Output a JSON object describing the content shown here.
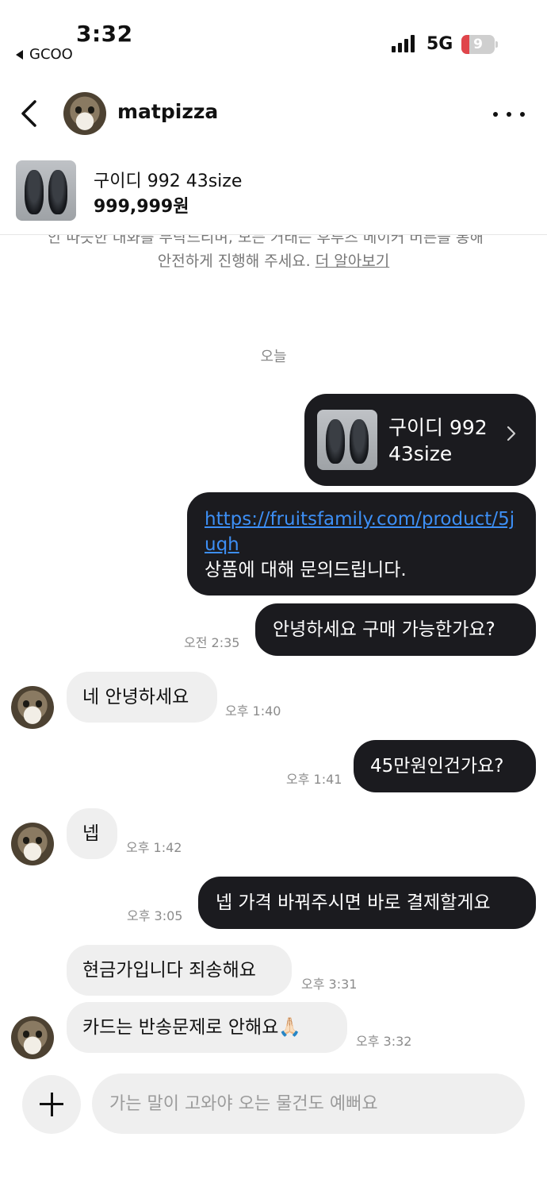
{
  "status_bar": {
    "time": "3:32",
    "back_app": "GCOO",
    "network": "5G",
    "battery": "9",
    "battery_level_pct": 9
  },
  "header": {
    "username": "matpizza"
  },
  "product": {
    "name": "구이디 992 43size",
    "price": "999,999원"
  },
  "notice": {
    "cut_text": "안 따뜻한 대화를 부탁드리며, 모든 거래는 후루츠 메이커 버튼을 통해",
    "text": "안전하게 진행해 주세요. ",
    "link": "더 알아보기"
  },
  "date_label": "오늘",
  "messages": {
    "product_card": {
      "title": "구이디 992 43size"
    },
    "link_msg": {
      "link": "https://fruitsfamily.com/product/5juqh",
      "text": "상품에 대해 문의드립니다."
    },
    "m1": {
      "text": "안녕하세요 구매 가능한가요?",
      "time": "오전 2:35"
    },
    "m2": {
      "text": "네 안녕하세요",
      "time": "오후 1:40"
    },
    "m3": {
      "text": "45만원인건가요?",
      "time": "오후 1:41"
    },
    "m4": {
      "text": "넵",
      "time": "오후 1:42"
    },
    "m5": {
      "text": "넵 가격 바꿔주시면 바로 결제할게요",
      "time": "오후 3:05"
    },
    "m6": {
      "text": "현금가입니다 죄송해요",
      "time": "오후 3:31"
    },
    "m7": {
      "text": "카드는 반송문제로 안해요🙏🏻",
      "time": "오후 3:32"
    }
  },
  "input": {
    "placeholder": "가는 말이 고와야 오는 물건도 예뻐요"
  },
  "icons": {
    "back": "chevron-left-icon",
    "more": "more-horizontal-icon",
    "chevron": "chevron-right-icon",
    "plus": "plus-icon"
  }
}
